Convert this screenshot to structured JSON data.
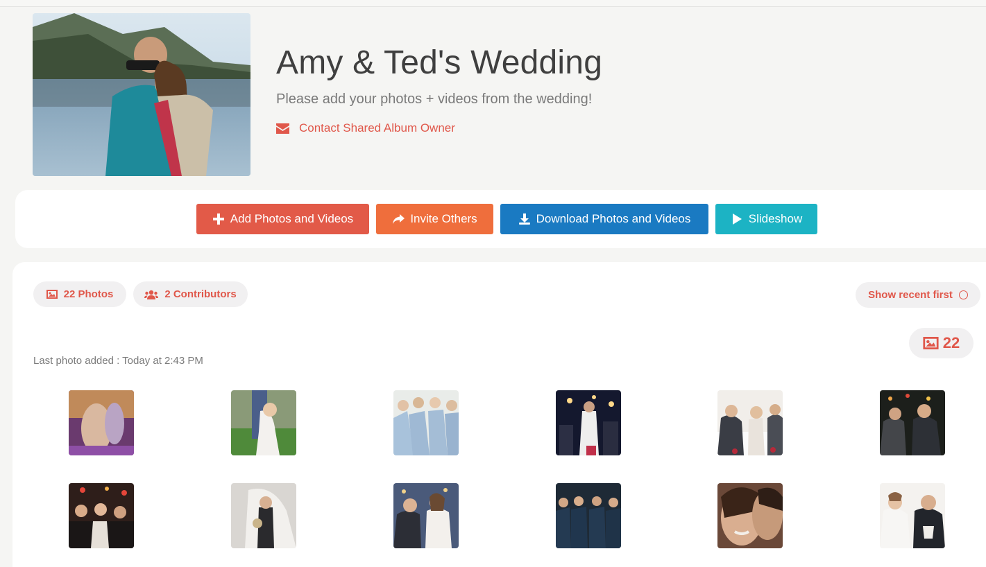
{
  "album": {
    "title": "Amy & Ted's Wedding",
    "subtitle": "Please add your photos + videos from the wedding!",
    "contact_label": "Contact Shared Album Owner",
    "cover_icon": "couple-photo"
  },
  "actions": {
    "add_label": "Add Photos and Videos",
    "invite_label": "Invite Others",
    "download_label": "Download Photos and Videos",
    "slideshow_label": "Slideshow"
  },
  "stats": {
    "photos_label": "22 Photos",
    "contributors_label": "2 Contributors",
    "sort_label": "Show recent first",
    "count": "22",
    "last_added": "Last photo added : Today at 2:43 PM"
  },
  "colors": {
    "accent": "#e0574a",
    "add": "#e25a48",
    "invite": "#ef6e3c",
    "download": "#1a7ac2",
    "slideshow": "#1cb3c4"
  }
}
